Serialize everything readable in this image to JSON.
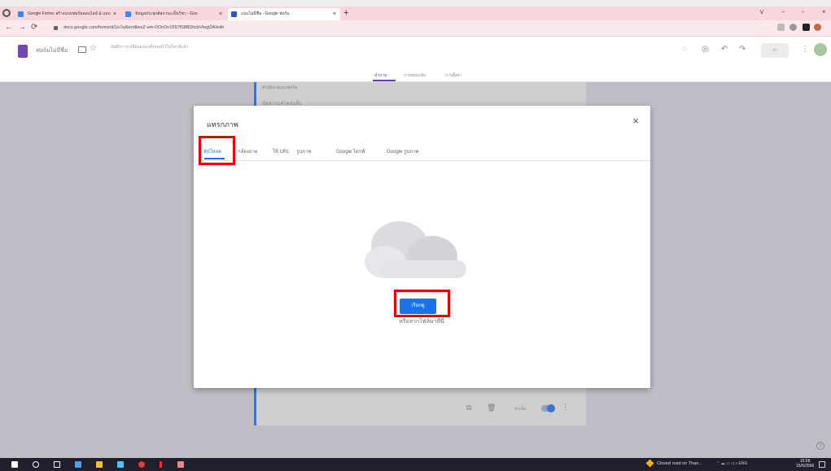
{
  "browser": {
    "tabs": [
      {
        "title": "Google Forms: สร้างแบบฟอร์มออนไลน์ & แบบ"
      },
      {
        "title": "ข้อมูลประยุกต์สถานะเป็นวิชา - Goo"
      },
      {
        "title": "แบบไม่มีชื่อ - Google ฟอร์ม"
      }
    ],
    "new_tab": "+",
    "url": "docs.google.com/forms/d/1e7aAizrdibxsZ-em-DOcDn1657fS8BDhcbVlegt2A/edit",
    "window_controls": [
      "v",
      "−",
      "▫",
      "×"
    ]
  },
  "forms_header": {
    "title": "ฟอร์มไม่มีชื่อ",
    "save_status": "บันทึกการเปลี่ยนแปลงทั้งหมดไว้ในไดรฟ์แล้ว",
    "send_label": "ส่ง",
    "tabs": [
      "คำถาม",
      "การตอบกลับ",
      "การตั้งค่า"
    ]
  },
  "background_form": {
    "line1": "คำอธิบายแบบฟอร์ม",
    "line2": "ข้อความคำตอบสั้น",
    "required_label": "จำเป็น"
  },
  "dialog": {
    "title": "แทรกภาพ",
    "close": "×",
    "tabs": [
      "อัปโหลด",
      "กล้องถ่าย",
      "ใช้ URL",
      "รูปภาพ",
      "Google ไดรฟ์",
      "Google รูปภาพ"
    ],
    "browse_label": "เรียกดู",
    "drop_hint": "หรือลากไฟล์มาที่นี่"
  },
  "taskbar": {
    "notification": "Closed road on Than...",
    "tray": "ENG",
    "time": "15:58",
    "date": "15/6/2566"
  },
  "highlight_color": "#e8000a",
  "accent_color": "#1a73e8",
  "forms_purple": "#673ab7"
}
